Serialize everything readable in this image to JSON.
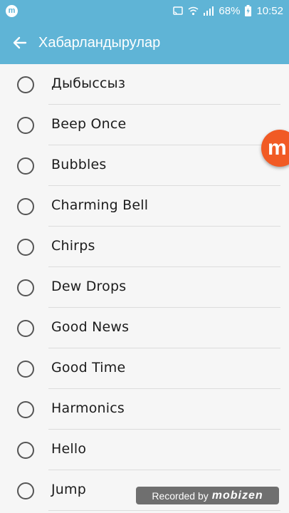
{
  "status_bar": {
    "app_icon_letter": "m",
    "battery": "68%",
    "time": "10:52"
  },
  "app_bar": {
    "title": "Хабарландырулар"
  },
  "ringtones": [
    "Дыбыссыз",
    "Beep Once",
    "Bubbles",
    "Charming Bell",
    "Chirps",
    "Dew Drops",
    "Good News",
    "Good Time",
    "Harmonics",
    "Hello",
    "Jump"
  ],
  "overlay": {
    "bubble_letter": "m",
    "watermark_prefix": "Recorded by",
    "watermark_brand": "mobizen"
  },
  "colors": {
    "header": "#5fb4d6",
    "bubble": "#f15a24"
  }
}
